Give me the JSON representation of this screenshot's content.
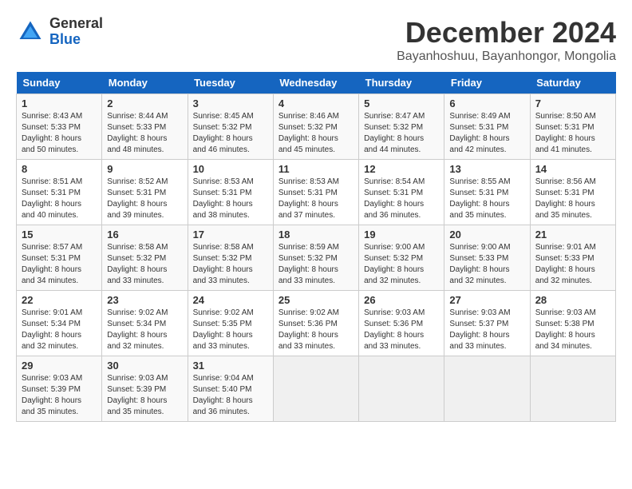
{
  "header": {
    "logo_line1": "General",
    "logo_line2": "Blue",
    "month_title": "December 2024",
    "location": "Bayanhoshuu, Bayanhongor, Mongolia"
  },
  "calendar": {
    "days_of_week": [
      "Sunday",
      "Monday",
      "Tuesday",
      "Wednesday",
      "Thursday",
      "Friday",
      "Saturday"
    ],
    "weeks": [
      [
        {
          "day": "",
          "empty": true
        },
        {
          "day": "",
          "empty": true
        },
        {
          "day": "",
          "empty": true
        },
        {
          "day": "",
          "empty": true
        },
        {
          "day": "",
          "empty": true
        },
        {
          "day": "",
          "empty": true
        },
        {
          "day": "",
          "empty": true
        }
      ],
      [
        {
          "day": "1",
          "sunrise": "Sunrise: 8:43 AM",
          "sunset": "Sunset: 5:33 PM",
          "daylight": "Daylight: 8 hours and 50 minutes."
        },
        {
          "day": "2",
          "sunrise": "Sunrise: 8:44 AM",
          "sunset": "Sunset: 5:33 PM",
          "daylight": "Daylight: 8 hours and 48 minutes."
        },
        {
          "day": "3",
          "sunrise": "Sunrise: 8:45 AM",
          "sunset": "Sunset: 5:32 PM",
          "daylight": "Daylight: 8 hours and 46 minutes."
        },
        {
          "day": "4",
          "sunrise": "Sunrise: 8:46 AM",
          "sunset": "Sunset: 5:32 PM",
          "daylight": "Daylight: 8 hours and 45 minutes."
        },
        {
          "day": "5",
          "sunrise": "Sunrise: 8:47 AM",
          "sunset": "Sunset: 5:32 PM",
          "daylight": "Daylight: 8 hours and 44 minutes."
        },
        {
          "day": "6",
          "sunrise": "Sunrise: 8:49 AM",
          "sunset": "Sunset: 5:31 PM",
          "daylight": "Daylight: 8 hours and 42 minutes."
        },
        {
          "day": "7",
          "sunrise": "Sunrise: 8:50 AM",
          "sunset": "Sunset: 5:31 PM",
          "daylight": "Daylight: 8 hours and 41 minutes."
        }
      ],
      [
        {
          "day": "8",
          "sunrise": "Sunrise: 8:51 AM",
          "sunset": "Sunset: 5:31 PM",
          "daylight": "Daylight: 8 hours and 40 minutes."
        },
        {
          "day": "9",
          "sunrise": "Sunrise: 8:52 AM",
          "sunset": "Sunset: 5:31 PM",
          "daylight": "Daylight: 8 hours and 39 minutes."
        },
        {
          "day": "10",
          "sunrise": "Sunrise: 8:53 AM",
          "sunset": "Sunset: 5:31 PM",
          "daylight": "Daylight: 8 hours and 38 minutes."
        },
        {
          "day": "11",
          "sunrise": "Sunrise: 8:53 AM",
          "sunset": "Sunset: 5:31 PM",
          "daylight": "Daylight: 8 hours and 37 minutes."
        },
        {
          "day": "12",
          "sunrise": "Sunrise: 8:54 AM",
          "sunset": "Sunset: 5:31 PM",
          "daylight": "Daylight: 8 hours and 36 minutes."
        },
        {
          "day": "13",
          "sunrise": "Sunrise: 8:55 AM",
          "sunset": "Sunset: 5:31 PM",
          "daylight": "Daylight: 8 hours and 35 minutes."
        },
        {
          "day": "14",
          "sunrise": "Sunrise: 8:56 AM",
          "sunset": "Sunset: 5:31 PM",
          "daylight": "Daylight: 8 hours and 35 minutes."
        }
      ],
      [
        {
          "day": "15",
          "sunrise": "Sunrise: 8:57 AM",
          "sunset": "Sunset: 5:31 PM",
          "daylight": "Daylight: 8 hours and 34 minutes."
        },
        {
          "day": "16",
          "sunrise": "Sunrise: 8:58 AM",
          "sunset": "Sunset: 5:32 PM",
          "daylight": "Daylight: 8 hours and 33 minutes."
        },
        {
          "day": "17",
          "sunrise": "Sunrise: 8:58 AM",
          "sunset": "Sunset: 5:32 PM",
          "daylight": "Daylight: 8 hours and 33 minutes."
        },
        {
          "day": "18",
          "sunrise": "Sunrise: 8:59 AM",
          "sunset": "Sunset: 5:32 PM",
          "daylight": "Daylight: 8 hours and 33 minutes."
        },
        {
          "day": "19",
          "sunrise": "Sunrise: 9:00 AM",
          "sunset": "Sunset: 5:32 PM",
          "daylight": "Daylight: 8 hours and 32 minutes."
        },
        {
          "day": "20",
          "sunrise": "Sunrise: 9:00 AM",
          "sunset": "Sunset: 5:33 PM",
          "daylight": "Daylight: 8 hours and 32 minutes."
        },
        {
          "day": "21",
          "sunrise": "Sunrise: 9:01 AM",
          "sunset": "Sunset: 5:33 PM",
          "daylight": "Daylight: 8 hours and 32 minutes."
        }
      ],
      [
        {
          "day": "22",
          "sunrise": "Sunrise: 9:01 AM",
          "sunset": "Sunset: 5:34 PM",
          "daylight": "Daylight: 8 hours and 32 minutes."
        },
        {
          "day": "23",
          "sunrise": "Sunrise: 9:02 AM",
          "sunset": "Sunset: 5:34 PM",
          "daylight": "Daylight: 8 hours and 32 minutes."
        },
        {
          "day": "24",
          "sunrise": "Sunrise: 9:02 AM",
          "sunset": "Sunset: 5:35 PM",
          "daylight": "Daylight: 8 hours and 33 minutes."
        },
        {
          "day": "25",
          "sunrise": "Sunrise: 9:02 AM",
          "sunset": "Sunset: 5:36 PM",
          "daylight": "Daylight: 8 hours and 33 minutes."
        },
        {
          "day": "26",
          "sunrise": "Sunrise: 9:03 AM",
          "sunset": "Sunset: 5:36 PM",
          "daylight": "Daylight: 8 hours and 33 minutes."
        },
        {
          "day": "27",
          "sunrise": "Sunrise: 9:03 AM",
          "sunset": "Sunset: 5:37 PM",
          "daylight": "Daylight: 8 hours and 33 minutes."
        },
        {
          "day": "28",
          "sunrise": "Sunrise: 9:03 AM",
          "sunset": "Sunset: 5:38 PM",
          "daylight": "Daylight: 8 hours and 34 minutes."
        }
      ],
      [
        {
          "day": "29",
          "sunrise": "Sunrise: 9:03 AM",
          "sunset": "Sunset: 5:39 PM",
          "daylight": "Daylight: 8 hours and 35 minutes."
        },
        {
          "day": "30",
          "sunrise": "Sunrise: 9:03 AM",
          "sunset": "Sunset: 5:39 PM",
          "daylight": "Daylight: 8 hours and 35 minutes."
        },
        {
          "day": "31",
          "sunrise": "Sunrise: 9:04 AM",
          "sunset": "Sunset: 5:40 PM",
          "daylight": "Daylight: 8 hours and 36 minutes."
        },
        {
          "day": "",
          "empty": true
        },
        {
          "day": "",
          "empty": true
        },
        {
          "day": "",
          "empty": true
        },
        {
          "day": "",
          "empty": true
        }
      ]
    ]
  }
}
